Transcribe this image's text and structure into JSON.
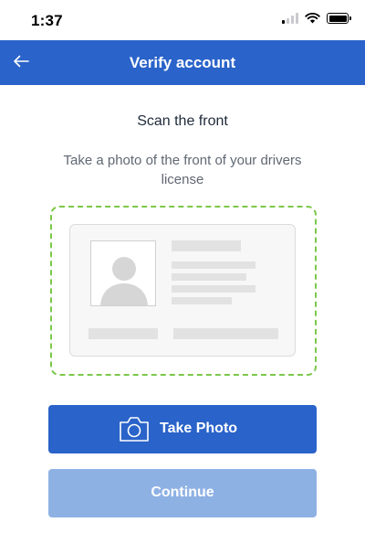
{
  "status_bar": {
    "time": "1:37",
    "icons": [
      "cellular-signal-icon",
      "wifi-icon",
      "battery-icon"
    ]
  },
  "header": {
    "title": "Verify account",
    "back_icon": "arrow-left-icon",
    "background_color": "#2a63c9"
  },
  "main": {
    "heading": "Scan the front",
    "instructions": "Take a photo of the front of your drivers license",
    "id_card_illustration": {
      "frame_color": "#7bc84a",
      "icon": "person-avatar-icon"
    }
  },
  "actions": {
    "take_photo_label": "Take Photo",
    "take_photo_icon": "camera-icon",
    "continue_label": "Continue",
    "continue_enabled": false
  }
}
